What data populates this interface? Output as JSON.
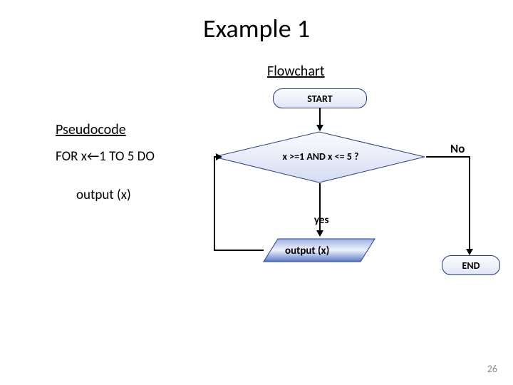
{
  "title": "Example 1",
  "flow_heading": "Flowchart",
  "pseudo_heading": "Pseudocode",
  "pseudo": {
    "line1": "FOR x←1 TO 5 DO",
    "line2": "output (x)"
  },
  "nodes": {
    "start": "START",
    "decision": "x >=1 AND x <= 5 ?",
    "output": "output (x)",
    "end": "END"
  },
  "labels": {
    "yes": "yes",
    "no": "No"
  },
  "page_number": "26",
  "chart_data": {
    "type": "flowchart",
    "nodes": [
      {
        "id": "start",
        "kind": "terminator",
        "text": "START"
      },
      {
        "id": "cond",
        "kind": "decision",
        "text": "x >=1 AND x <= 5 ?"
      },
      {
        "id": "out",
        "kind": "io",
        "text": "output (x)"
      },
      {
        "id": "end",
        "kind": "terminator",
        "text": "END"
      }
    ],
    "edges": [
      {
        "from": "start",
        "to": "cond"
      },
      {
        "from": "cond",
        "to": "out",
        "label": "yes"
      },
      {
        "from": "cond",
        "to": "end",
        "label": "No"
      },
      {
        "from": "out",
        "to": "cond"
      }
    ],
    "pseudocode": [
      "FOR x ← 1 TO 5 DO",
      "  output (x)"
    ]
  }
}
